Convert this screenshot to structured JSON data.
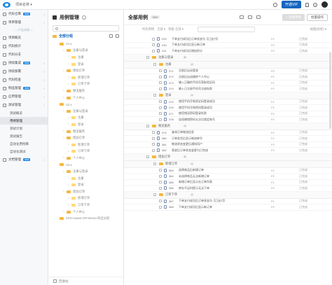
{
  "topbar": {
    "project": "项目名称 ▾",
    "vip_label": "开通VIP"
  },
  "sidebar": {
    "items": [
      {
        "label": "代码仓库",
        "tag": "new",
        "arrow": true
      },
      {
        "label": "项目管理",
        "arrow": true
      },
      {
        "divider": "— 产品文档 —"
      },
      {
        "label": "项目概览"
      },
      {
        "label": "代码统计"
      },
      {
        "label": "代码分支"
      },
      {
        "label": "持续集成",
        "tag": "new",
        "arrow": true
      },
      {
        "label": "持续部署",
        "arrow": true
      },
      {
        "label": "代码检查",
        "arrow": true
      },
      {
        "label": "制品管理",
        "tag": "new",
        "arrow": true
      },
      {
        "label": "应用管理",
        "arrow": true
      },
      {
        "label": "测试管理",
        "arrow": true
      },
      {
        "sub": "测试概览"
      },
      {
        "sub": "用例管理",
        "active": true
      },
      {
        "sub": "测试计划"
      },
      {
        "sub": "测试报告"
      },
      {
        "sub": "自动化用例库"
      },
      {
        "sub": "自动化测试"
      },
      {
        "label": "文档管理",
        "tag": "new",
        "arrow": true
      }
    ]
  },
  "tree": {
    "title": "用例管理",
    "help": "?",
    "root": "全部分组",
    "nodes": [
      {
        "label": "V1.x",
        "lv": 1
      },
      {
        "label": "注册与登录",
        "lv": 2
      },
      {
        "label": "注册",
        "lv": 3
      },
      {
        "label": "登录",
        "lv": 3
      },
      {
        "label": "增加订单",
        "lv": 2
      },
      {
        "label": "新增订单",
        "lv": 3
      },
      {
        "label": "订单下单",
        "lv": 3
      },
      {
        "label": "物流服务",
        "lv": 2
      },
      {
        "label": "个人中心",
        "lv": 2
      },
      {
        "label": "V2.x",
        "lv": 1
      },
      {
        "label": "注册与登录",
        "lv": 2
      },
      {
        "label": "注册",
        "lv": 3
      },
      {
        "label": "登录",
        "lv": 3
      },
      {
        "label": "物流服务",
        "lv": 2
      },
      {
        "label": "增加订单",
        "lv": 2
      },
      {
        "label": "新增订单",
        "lv": 3
      },
      {
        "label": "订单下单",
        "lv": 3
      },
      {
        "label": "个人中心",
        "lv": 2
      },
      {
        "label": "V3.x",
        "lv": 1
      },
      {
        "label": "注册与登录",
        "lv": 2
      },
      {
        "label": "注册",
        "lv": 3
      },
      {
        "label": "登录",
        "lv": 3
      },
      {
        "label": "增加订单",
        "lv": 2
      },
      {
        "label": "新增订单",
        "lv": 3
      },
      {
        "label": "订单下单",
        "lv": 3
      },
      {
        "label": "个人中心",
        "lv": 2
      },
      {
        "label": "XXX-Cases-API-Demo-导出分组",
        "lv": 1
      }
    ],
    "footer": "回收站"
  },
  "main": {
    "title": "全部用例",
    "count": "283",
    "new_btn": "+ 创建用例",
    "more_btn": "批量操作",
    "filter": {
      "all": "所有用例",
      "sort1": "全部 ▾",
      "sort2": "等级 全部 ▾",
      "view": "视图(树状) ▾"
    },
    "rows": [
      {
        "k": "row",
        "indent": 0,
        "id": "229",
        "title": "下单支付成功后订单状态为【已支付】",
        "lv": "P1",
        "st": "已完成"
      },
      {
        "k": "row",
        "indent": 0,
        "id": "230",
        "title": "下单支付成功后显示新订单",
        "lv": "P2",
        "st": "已完成"
      },
      {
        "k": "row",
        "indent": 0,
        "id": "231",
        "title": "下单支付成功后增加积分",
        "lv": "P2",
        "st": "已完成"
      },
      {
        "k": "grp",
        "indent": 0,
        "name": "注册与登录",
        "cnt": "8"
      },
      {
        "k": "grp",
        "indent": 1,
        "name": "注册",
        "cnt": "4"
      },
      {
        "k": "row",
        "indent": 1,
        "id": "371",
        "title": "注册后自动登录",
        "lv": "P0",
        "st": "已完成"
      },
      {
        "k": "row",
        "indent": 1,
        "id": "372",
        "title": "注册后自动跳转个人中心",
        "lv": "P1",
        "st": "已完成"
      },
      {
        "k": "row",
        "indent": 1,
        "id": "373",
        "title": "输入正确的手机号获取验证码",
        "lv": "P1",
        "st": "已完成"
      },
      {
        "k": "row",
        "indent": 1,
        "id": "374",
        "title": "输入已注册手机号注册失败",
        "lv": "P2",
        "st": "已完成"
      },
      {
        "k": "grp",
        "indent": 1,
        "name": "登录",
        "cnt": "4"
      },
      {
        "k": "row",
        "indent": 1,
        "id": "375",
        "title": "使用手机号和验证码登录成功",
        "lv": "P1",
        "st": "已完成"
      },
      {
        "k": "row",
        "indent": 1,
        "id": "376",
        "title": "使用手机号和密码登录成功",
        "lv": "P1",
        "st": "已完成"
      },
      {
        "k": "row",
        "indent": 1,
        "id": "377",
        "title": "使用错误密码登录失败",
        "lv": "P2",
        "st": "已完成"
      },
      {
        "k": "row",
        "indent": 1,
        "id": "378",
        "title": "连续输错密码五次后锁定账号",
        "lv": "P2",
        "st": "已完成"
      },
      {
        "k": "grp",
        "indent": 0,
        "name": "物流服务",
        "cnt": "4"
      },
      {
        "k": "row",
        "indent": 0,
        "id": "379",
        "title": "查询订单物流信息",
        "lv": "P1",
        "st": "已完成"
      },
      {
        "k": "row",
        "indent": 0,
        "id": "380",
        "title": "订单发货后显示物流单号",
        "lv": "P1",
        "st": "已完成"
      },
      {
        "k": "row",
        "indent": 0,
        "id": "381",
        "title": "物流状态变更后通知用户",
        "lv": "P2",
        "st": "已完成"
      },
      {
        "k": "row",
        "indent": 0,
        "id": "382",
        "title": "签收后订单状态变更为已完成",
        "lv": "P2",
        "st": "已完成"
      },
      {
        "k": "grp",
        "indent": 0,
        "name": "增加订单",
        "cnt": "8"
      },
      {
        "k": "grp",
        "indent": 1,
        "name": "新增订单",
        "cnt": "4"
      },
      {
        "k": "row",
        "indent": 1,
        "id": "383",
        "title": "选择商品后新增订单",
        "lv": "P1",
        "st": "已完成"
      },
      {
        "k": "row",
        "indent": 1,
        "id": "384",
        "title": "未选择商品无法新增订单",
        "lv": "P2",
        "st": "已完成"
      },
      {
        "k": "row",
        "indent": 1,
        "id": "385",
        "title": "新增订单后显示在订单列表",
        "lv": "P1",
        "st": "已完成"
      },
      {
        "k": "row",
        "indent": 1,
        "id": "386",
        "title": "库存不足时提示无法下单",
        "lv": "P2",
        "st": "已完成"
      },
      {
        "k": "grp",
        "indent": 1,
        "name": "订单下单",
        "cnt": "4"
      },
      {
        "k": "row",
        "indent": 1,
        "id": "387",
        "title": "下单支付成功后订单状态为【已支付】",
        "lv": "P1",
        "st": "已完成"
      },
      {
        "k": "row",
        "indent": 1,
        "id": "388",
        "title": "下单支付成功后显示新订单",
        "lv": "P2",
        "st": "已完成"
      }
    ]
  }
}
